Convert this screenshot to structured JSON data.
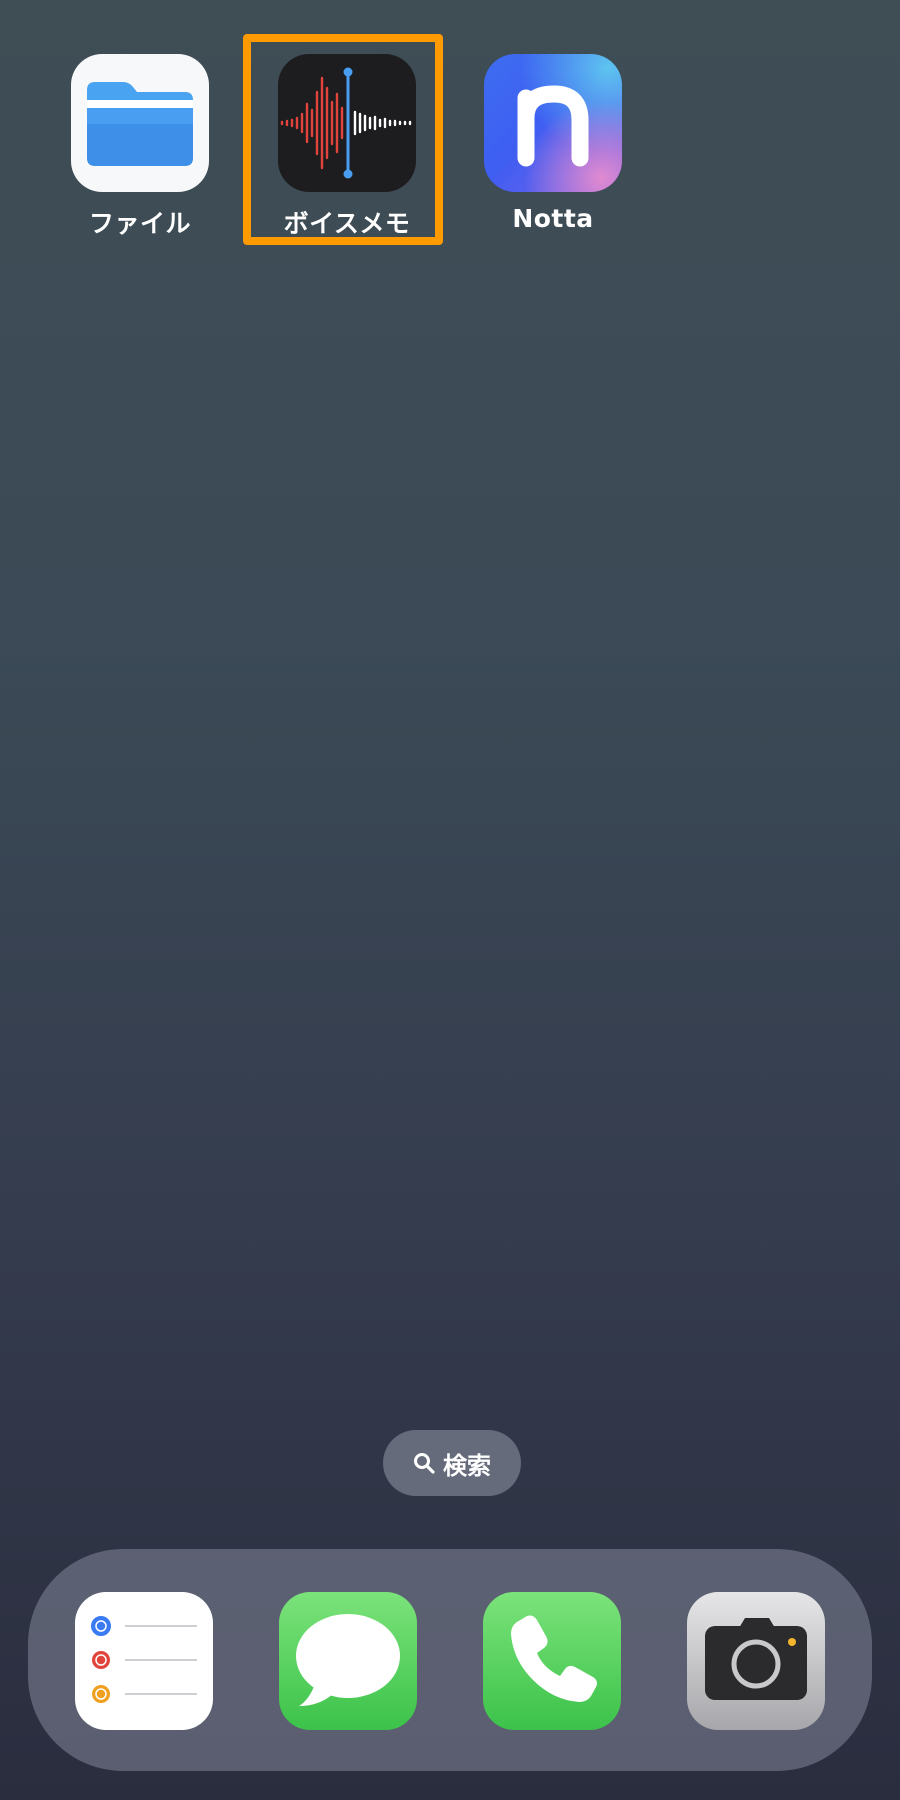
{
  "home_screen": {
    "apps": [
      {
        "label": "ファイル",
        "icon": "files-folder-icon"
      },
      {
        "label": "ボイスメモ",
        "icon": "voice-memos-waveform-icon",
        "highlighted": true
      },
      {
        "label": "Notta",
        "icon": "notta-n-icon"
      }
    ],
    "highlight_color": "#ff9a00"
  },
  "search": {
    "label": "検索",
    "icon": "search-icon"
  },
  "dock": {
    "apps": [
      {
        "name": "reminders",
        "icon": "reminders-icon"
      },
      {
        "name": "messages",
        "icon": "messages-bubble-icon"
      },
      {
        "name": "phone",
        "icon": "phone-handset-icon"
      },
      {
        "name": "camera",
        "icon": "camera-icon"
      }
    ]
  }
}
